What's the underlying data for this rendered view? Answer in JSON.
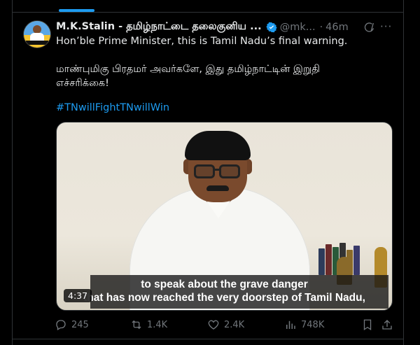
{
  "tweet": {
    "author_name": "M.K.Stalin - தமிழ்நாட்டை தலைகுனிய ...",
    "handle": "@mk...",
    "separator": "·",
    "time": "46m",
    "more_label": "···",
    "text_line1": "Hon’ble Prime Minister, this is Tamil Nadu’s final warning.",
    "text_line2": "மாண்புமிகு பிரதமர் அவர்களே, இது தமிழ்நாட்டின் இறுதி",
    "text_line3": "எச்சரிக்கை!",
    "hashtag": "#TNwillFightTNwillWin"
  },
  "video": {
    "subtitle_line1": "to speak about the grave danger",
    "subtitle_line2": "that has now reached the very doorstep of Tamil Nadu,",
    "duration": "4:37"
  },
  "actions": {
    "replies": "245",
    "reposts": "1.4K",
    "likes": "2.4K",
    "views": "748K"
  },
  "colors": {
    "accent": "#1d9bf0",
    "muted": "#71767b",
    "background": "#000000"
  },
  "icons": [
    "verified-badge-icon",
    "grok-icon",
    "more-icon",
    "reply-icon",
    "repost-icon",
    "like-icon",
    "views-icon",
    "bookmark-icon",
    "share-icon"
  ]
}
